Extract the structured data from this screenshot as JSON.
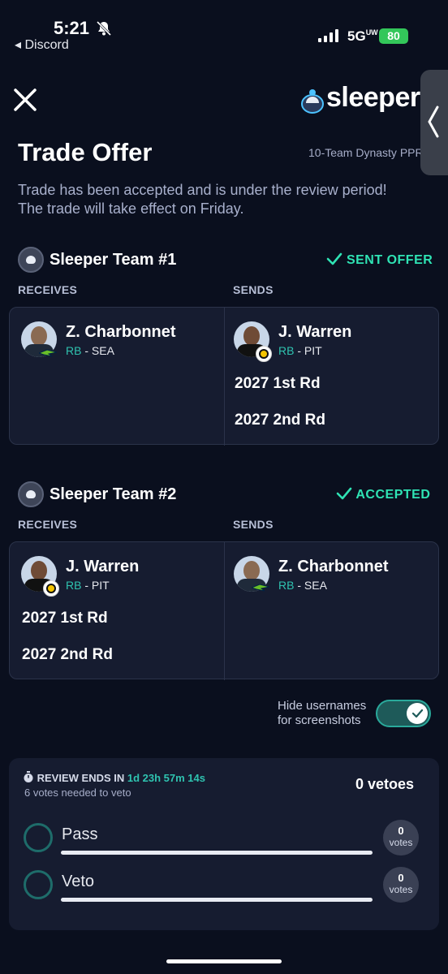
{
  "status_bar": {
    "time": "5:21",
    "back_label": "◂ Discord",
    "network": "5G",
    "network_sub": "UW",
    "battery": "80"
  },
  "header": {
    "app_name": "sleeper",
    "title": "Trade Offer",
    "league": "10-Team Dynasty PPR"
  },
  "notice": "Trade has been accepted and is under the review period! The trade will take effect on Friday.",
  "teams": [
    {
      "name": "Sleeper Team #1",
      "status": "SENT OFFER",
      "receives_label": "RECEIVES",
      "sends_label": "SENDS",
      "receives": [
        {
          "name": "Z. Charbonnet",
          "pos": "RB",
          "team": " - SEA"
        }
      ],
      "sends_player": {
        "name": "J. Warren",
        "pos": "RB",
        "team": " - PIT"
      },
      "sends_picks": [
        "2027 1st Rd",
        "2027 2nd Rd"
      ]
    },
    {
      "name": "Sleeper Team #2",
      "status": "ACCEPTED",
      "receives_label": "RECEIVES",
      "sends_label": "SENDS",
      "receives_player": {
        "name": "J. Warren",
        "pos": "RB",
        "team": " - PIT"
      },
      "receives_picks": [
        "2027 1st Rd",
        "2027 2nd Rd"
      ],
      "sends": [
        {
          "name": "Z. Charbonnet",
          "pos": "RB",
          "team": " - SEA"
        }
      ]
    }
  ],
  "toggle": {
    "label": "Hide usernames for screenshots",
    "on": true
  },
  "review": {
    "title_prefix": "REVIEW ENDS IN",
    "countdown": "1d 23h 57m 14s",
    "votes_needed": "6 votes needed to veto",
    "vetoes": "0 vetoes",
    "options": [
      {
        "label": "Pass",
        "count": "0",
        "unit": "votes"
      },
      {
        "label": "Veto",
        "count": "0",
        "unit": "votes"
      }
    ]
  },
  "colors": {
    "accent": "#2fe3b4",
    "background": "#0a0f1e",
    "card": "#161c30"
  }
}
